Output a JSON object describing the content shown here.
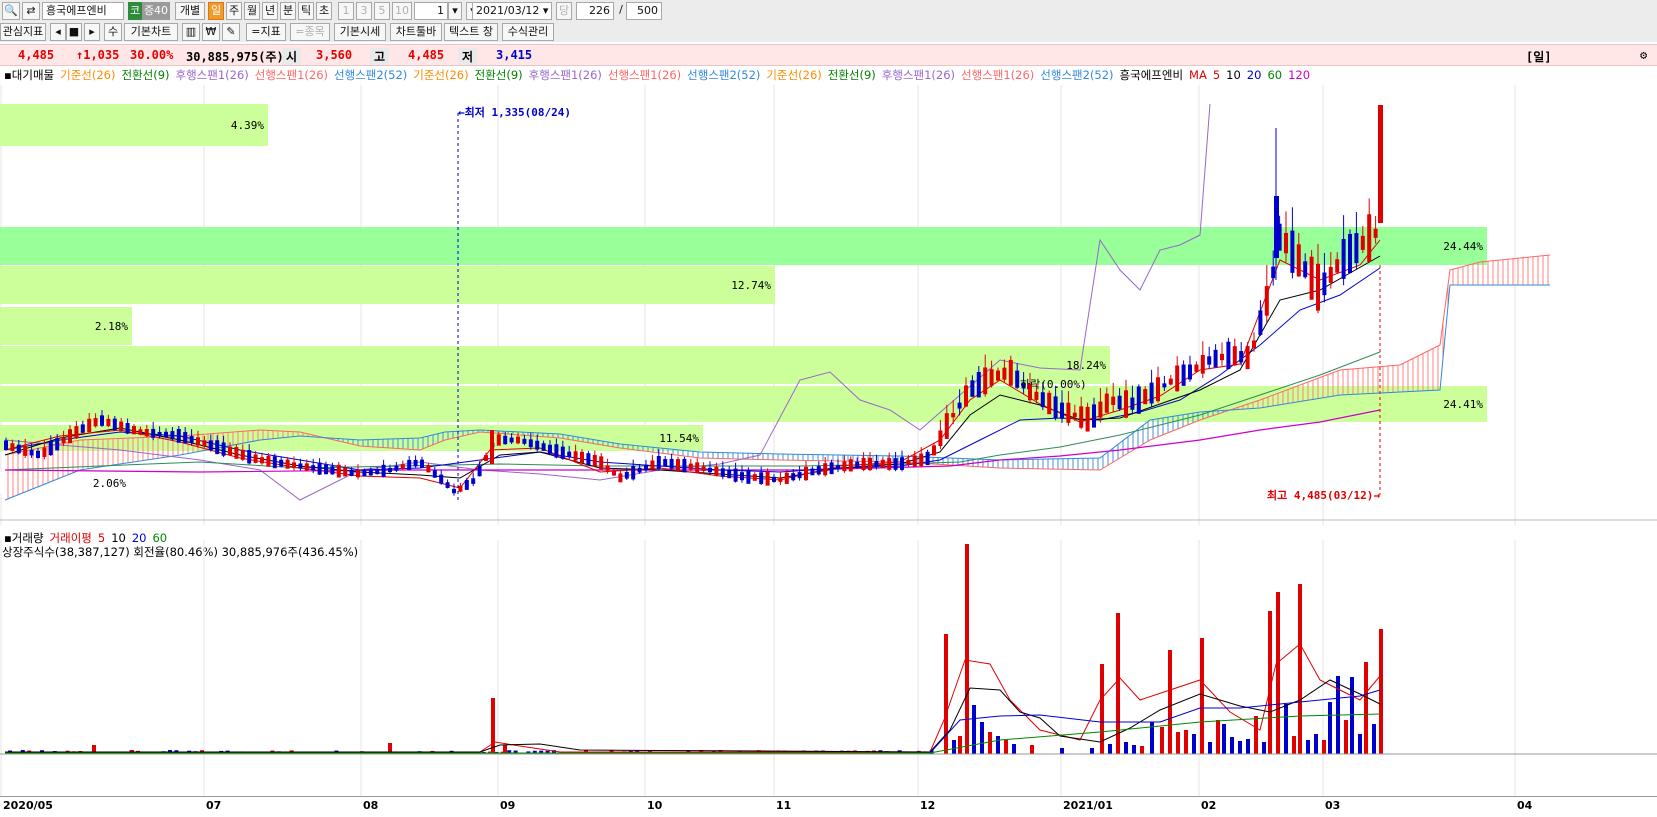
{
  "toolbar": {
    "stock_name": "흥국에프엔비",
    "market_badge": "코",
    "margin_badge": "증40",
    "mode_label": "개별",
    "periods": [
      "일",
      "주",
      "월",
      "년",
      "분",
      "틱",
      "초"
    ],
    "selected_period": "일",
    "intervals": [
      "1",
      "3",
      "5",
      "10"
    ],
    "interval_value": "1",
    "date": "2021/03/12",
    "count_label": "당",
    "count_value": "226",
    "separator": "/",
    "total_value": "500",
    "search_icon": "search-icon",
    "refresh_icon": "refresh-icon"
  },
  "toolbar2": {
    "watchlist_label": "관심지표",
    "add_label": "수",
    "basic_chart_label": "기본차트",
    "indicator_label": "=지표",
    "stock_label": "=종목",
    "basic_quote_label": "기본시세",
    "chart_toolbar_label": "차트툴바",
    "text_window_label": "텍스트 창",
    "formula_label": "수식관리"
  },
  "quote": {
    "price": "4,485",
    "change": "↑1,035",
    "change_pct": "30.00%",
    "volume": "30,885,975(주)",
    "open_label": "시",
    "open": "3,560",
    "high_label": "고",
    "high": "4,485",
    "low_label": "저",
    "low": "3,415",
    "period_tag": "[일]"
  },
  "main_legend": [
    {
      "text": "대기매물",
      "color": "#000000"
    },
    {
      "text": "기준선(26)",
      "color": "#ff8c00"
    },
    {
      "text": "전환선(9)",
      "color": "#008000"
    },
    {
      "text": "후행스팬1(26)",
      "color": "#9966cc"
    },
    {
      "text": "선행스팬1(26)",
      "color": "#ff6666"
    },
    {
      "text": "선행스팬2(52)",
      "color": "#3388dd"
    },
    {
      "text": "기준선(26)",
      "color": "#ff8c00"
    },
    {
      "text": "전환선(9)",
      "color": "#008000"
    },
    {
      "text": "후행스팬1(26)",
      "color": "#9966cc"
    },
    {
      "text": "선행스팬1(26)",
      "color": "#ff6666"
    },
    {
      "text": "선행스팬2(52)",
      "color": "#3388dd"
    },
    {
      "text": "기준선(26)",
      "color": "#ff8c00"
    },
    {
      "text": "전환선(9)",
      "color": "#008000"
    },
    {
      "text": "후행스팬1(26)",
      "color": "#9966cc"
    },
    {
      "text": "선행스팬1(26)",
      "color": "#ff6666"
    },
    {
      "text": "선행스팬2(52)",
      "color": "#3388dd"
    },
    {
      "text": "흥국에프엔비",
      "color": "#000000"
    },
    {
      "text": "MA",
      "color": "#e00000"
    },
    {
      "text": "5",
      "color": "#e00000"
    },
    {
      "text": "10",
      "color": "#000000"
    },
    {
      "text": "20",
      "color": "#0000cc"
    },
    {
      "text": "60",
      "color": "#008800"
    },
    {
      "text": "120",
      "color": "#cc00cc"
    }
  ],
  "annotations": {
    "low": "←최저 1,335(08/24)",
    "high": "최고 4,485(03/12)→",
    "fall": "하락(0.00%)"
  },
  "volume_profile": [
    "4.39%",
    "24.44%",
    "12.74%",
    "2.18%",
    "18.24%",
    "24.41%",
    "11.54%",
    "2.06%"
  ],
  "volume_legend": [
    {
      "text": "거래량",
      "color": "#000000"
    },
    {
      "text": "거래이평",
      "color": "#e00000"
    },
    {
      "text": "5",
      "color": "#e00000"
    },
    {
      "text": "10",
      "color": "#000000"
    },
    {
      "text": "20",
      "color": "#0000cc"
    },
    {
      "text": "60",
      "color": "#008800"
    }
  ],
  "volume_info": "상장주식수(38,387,127) 회전율(80.46%) 30,885,976주(436.45%)",
  "x_axis_labels": [
    "2020/05",
    "07",
    "08",
    "09",
    "10",
    "11",
    "12",
    "2021/01",
    "02",
    "03",
    "04"
  ],
  "colors": {
    "up": "#e00000",
    "down": "#0000cc",
    "profile": "#ccff99",
    "profile_peak": "#99ff99"
  }
}
